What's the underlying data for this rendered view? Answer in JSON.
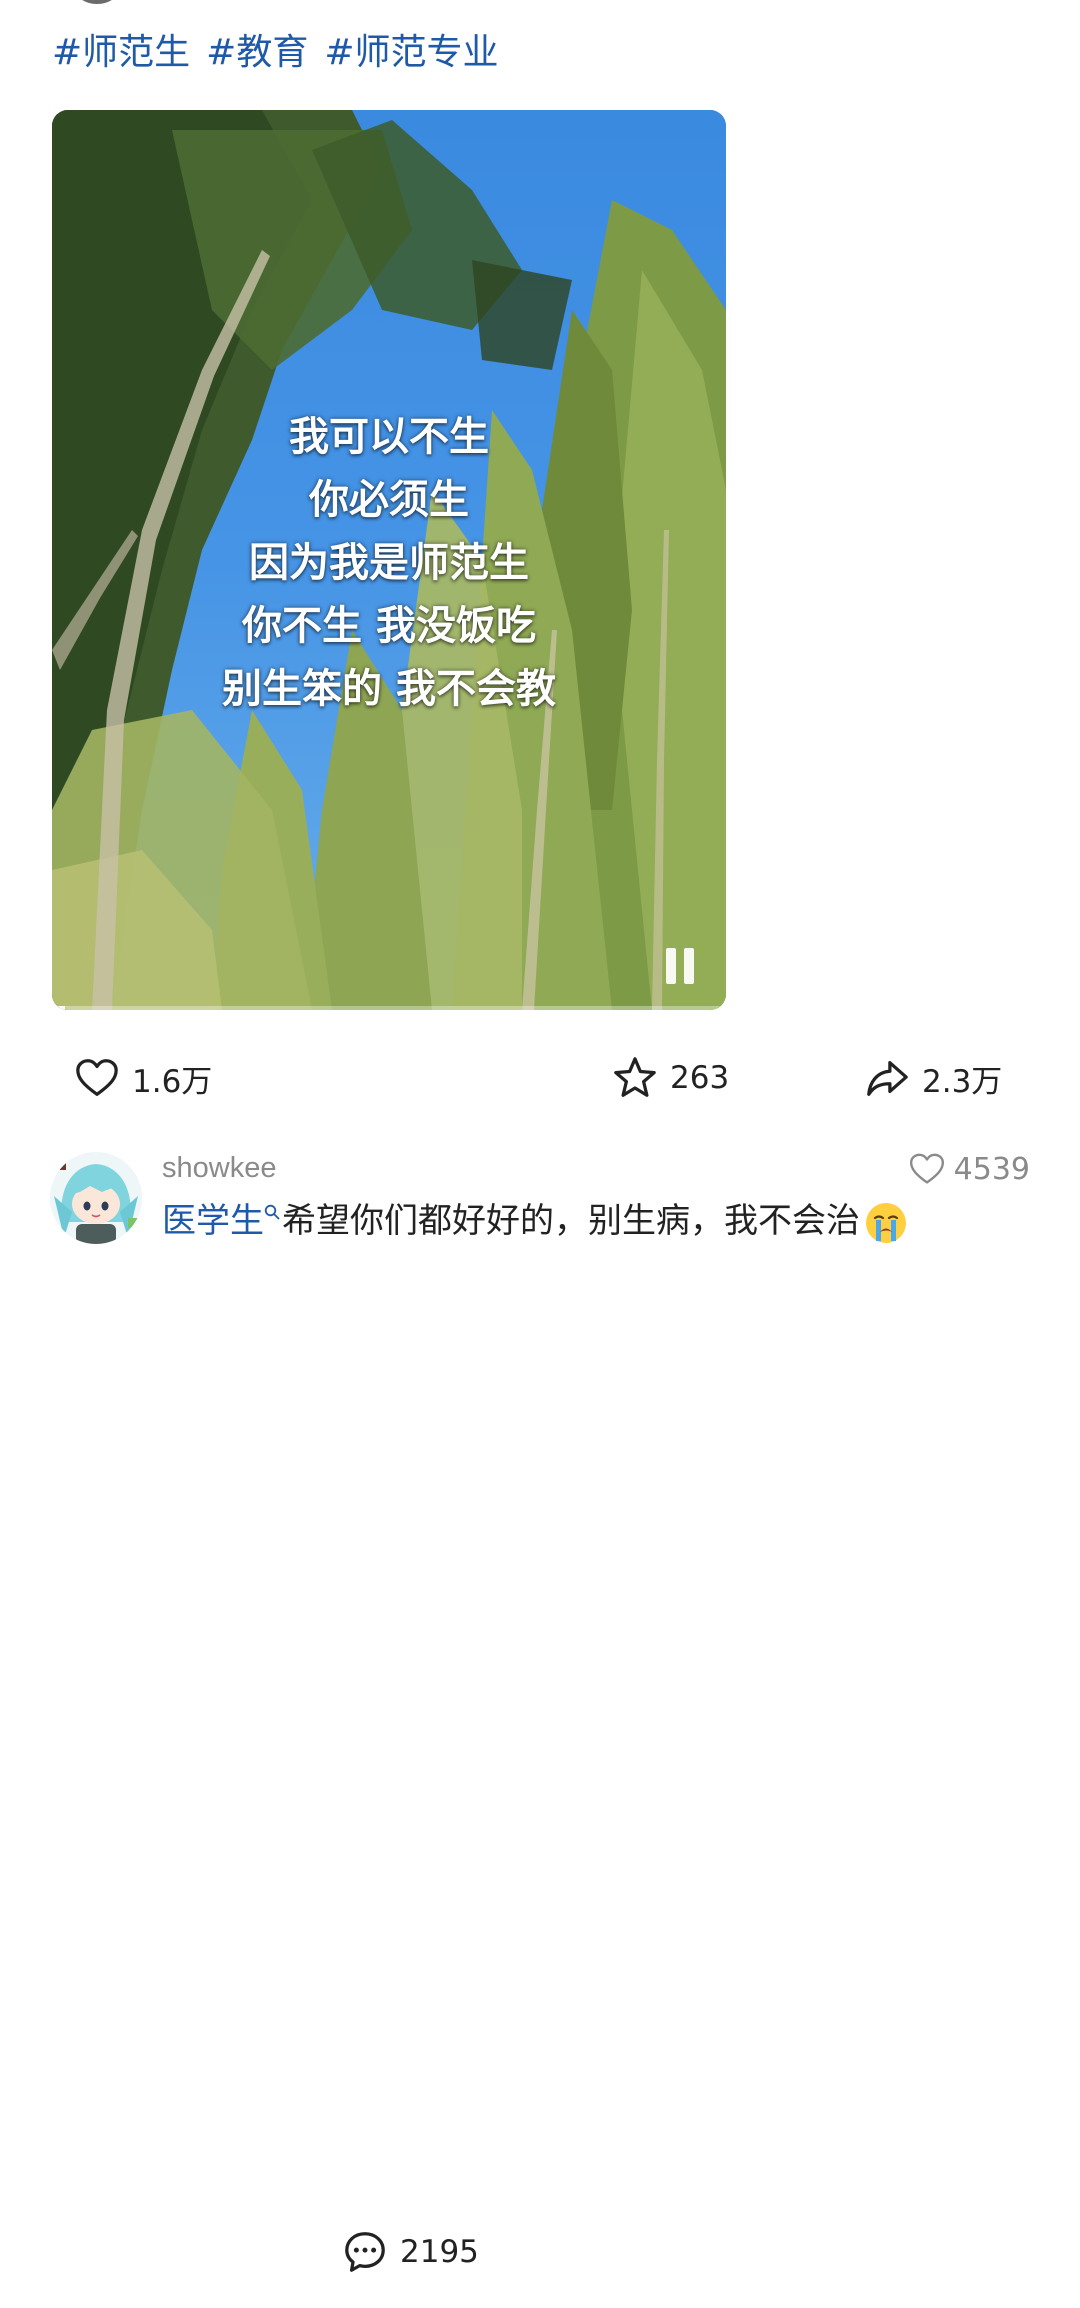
{
  "post": {
    "hashtags": [
      "#师范生",
      "#教育",
      "#师范专业"
    ],
    "video": {
      "overlay_lines": [
        "我可以不生",
        "你必须生",
        "因为我是师范生",
        "你不生 我没饭吃",
        "别生笨的 我不会教"
      ],
      "progress": 0.02
    },
    "actions": {
      "like_count": "1.6万",
      "comment_count": "2195",
      "favorite_count": "263",
      "share_count": "2.3万"
    }
  },
  "comment": {
    "username": "showkee",
    "like_count": "4539",
    "link_text": "医学生",
    "text": "希望你们都好好的，别生病，我不会治"
  }
}
